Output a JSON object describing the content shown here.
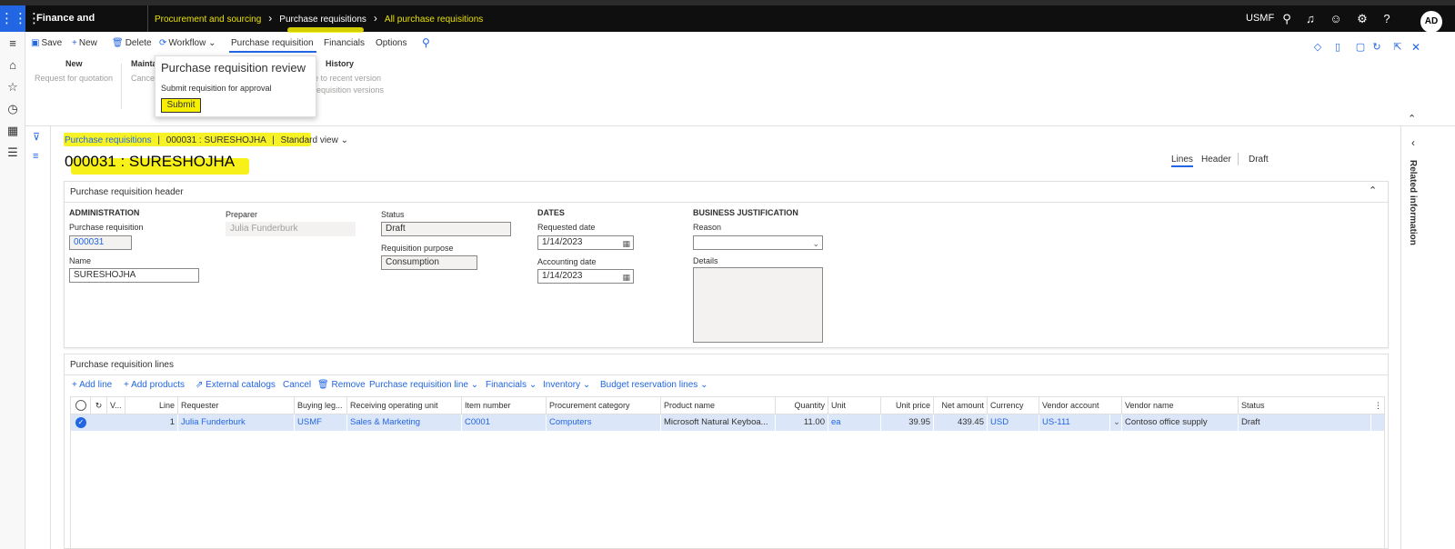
{
  "nav": {
    "app_title": "Finance and Operations",
    "crumbs": [
      "Procurement and sourcing",
      "Purchase requisitions",
      "All purchase requisitions"
    ],
    "company": "USMF",
    "avatar": "AD"
  },
  "action_pane": {
    "save": "Save",
    "new": "New",
    "delete": "Delete",
    "workflow": "Workflow",
    "tab_active": "Purchase requisition",
    "tab_financials": "Financials",
    "tab_options": "Options",
    "groups": {
      "new_title": "New",
      "new_item": "Request for quotation",
      "maintain_title": "Maintai",
      "maintain_item": "Cance",
      "history_title": "History",
      "history_item1": "e to recent version",
      "history_item2": "requisition versions"
    }
  },
  "popup": {
    "title": "Purchase requisition review",
    "description": "Submit requisition for approval",
    "submit": "Submit"
  },
  "page": {
    "crumb_link": "Purchase requisitions",
    "crumb_record": "000031 : SURESHOJHA",
    "crumb_view": "Standard view",
    "title": "000031 : SURESHOJHA",
    "tabs": {
      "lines": "Lines",
      "header": "Header",
      "status": "Draft"
    },
    "related": "Related information"
  },
  "header_card": {
    "title": "Purchase requisition header",
    "administration": {
      "section": "ADMINISTRATION",
      "pr_label": "Purchase requisition",
      "pr_value": "000031",
      "name_label": "Name",
      "name_value": "SURESHOJHA"
    },
    "preparer": {
      "label": "Preparer",
      "value": "Julia Funderburk"
    },
    "status": {
      "label": "Status",
      "value": "Draft",
      "purpose_label": "Requisition purpose",
      "purpose_value": "Consumption"
    },
    "dates": {
      "section": "DATES",
      "requested_label": "Requested date",
      "requested_value": "1/14/2023",
      "accounting_label": "Accounting date",
      "accounting_value": "1/14/2023"
    },
    "justification": {
      "section": "BUSINESS JUSTIFICATION",
      "reason_label": "Reason",
      "reason_value": "",
      "details_label": "Details"
    }
  },
  "lines_card": {
    "title": "Purchase requisition lines",
    "actions": {
      "add_line": "Add line",
      "add_products": "Add products",
      "external_catalogs": "External catalogs",
      "cancel": "Cancel",
      "remove": "Remove",
      "pr_line": "Purchase requisition line",
      "financials": "Financials",
      "inventory": "Inventory",
      "budget": "Budget reservation lines"
    },
    "columns": {
      "v": "V...",
      "line": "Line",
      "requester": "Requester",
      "buying": "Buying leg...",
      "rou": "Receiving operating unit",
      "item": "Item number",
      "category": "Procurement category",
      "product": "Product name",
      "qty": "Quantity",
      "unit": "Unit",
      "price": "Unit price",
      "net": "Net amount",
      "currency": "Currency",
      "vendor_acc": "Vendor account",
      "vendor_name": "Vendor name",
      "status": "Status"
    },
    "row": {
      "line": "1",
      "requester": "Julia Funderburk",
      "buying": "USMF",
      "rou": "Sales & Marketing",
      "item": "C0001",
      "category": "Computers",
      "product": "Microsoft Natural Keyboa...",
      "qty": "11.00",
      "unit": "ea",
      "price": "39.95",
      "net": "439.45",
      "currency": "USD",
      "vendor_acc": "US-111",
      "vendor_name": "Contoso office supply",
      "status": "Draft"
    }
  }
}
